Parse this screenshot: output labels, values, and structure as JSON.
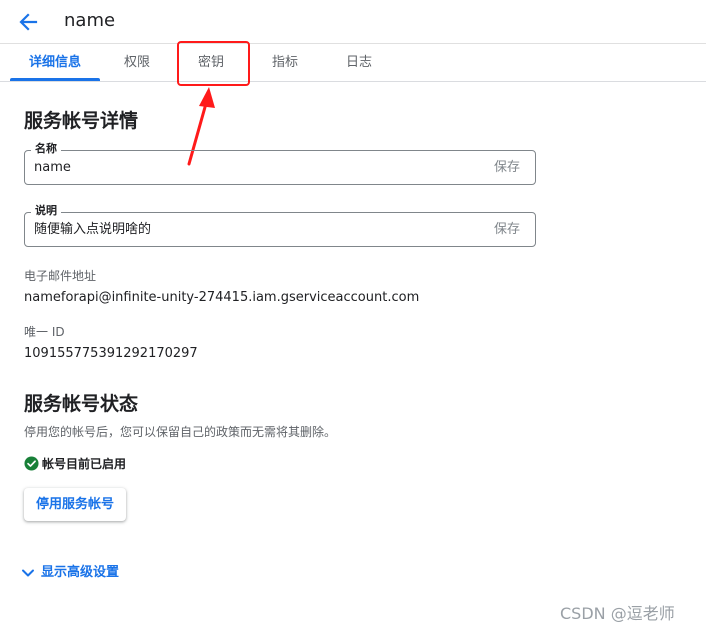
{
  "header": {
    "title": "name",
    "back_icon": "arrow-back-icon"
  },
  "tabs": [
    {
      "label": "详细信息",
      "active": true
    },
    {
      "label": "权限",
      "active": false
    },
    {
      "label": "密钥",
      "active": false
    },
    {
      "label": "指标",
      "active": false
    },
    {
      "label": "日志",
      "active": false
    }
  ],
  "annotation": {
    "color": "#ff1a1a"
  },
  "details": {
    "heading": "服务帐号详情",
    "name_field": {
      "label": "名称",
      "value": "name",
      "action": "保存"
    },
    "description_field": {
      "label": "说明",
      "value": "随便输入点说明啥的",
      "action": "保存"
    },
    "email": {
      "label": "电子邮件地址",
      "value": "nameforapi@infinite-unity-274415.iam.gserviceaccount.com"
    },
    "unique_id": {
      "label": "唯一 ID",
      "value": "109155775391292170297"
    }
  },
  "status": {
    "heading": "服务帐号状态",
    "description": "停用您的帐号后，您可以保留自己的政策而无需将其删除。",
    "state_text": "帐号目前已启用",
    "state_icon": "check-circle-icon",
    "disable_button": "停用服务帐号"
  },
  "advanced": {
    "label": "显示高级设置",
    "icon": "chevron-down-icon"
  },
  "watermark": "CSDN @逗老师",
  "colors": {
    "accent": "#1a73e8",
    "success": "#188038",
    "annotation": "#ff1a1a"
  }
}
